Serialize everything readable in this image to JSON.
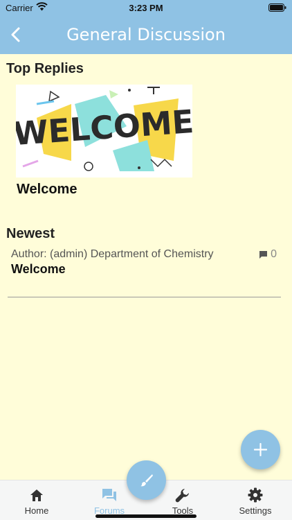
{
  "status_bar": {
    "carrier": "Carrier",
    "time": "3:23 PM"
  },
  "nav": {
    "title": "General Discussion",
    "back_icon": "chevron-left-icon"
  },
  "top_replies": {
    "heading": "Top Replies",
    "items": [
      {
        "image_text": "WELCOME",
        "title": "Welcome"
      }
    ]
  },
  "newest": {
    "heading": "Newest",
    "items": [
      {
        "author": "Author: (admin) Department of Chemistry",
        "title": "Welcome",
        "comments": "0"
      }
    ]
  },
  "fab": {
    "add_icon": "plus-icon",
    "compose_icon": "brush-icon"
  },
  "tabs": [
    {
      "label": "Home",
      "icon": "home-icon",
      "active": false
    },
    {
      "label": "Forums",
      "icon": "forum-icon",
      "active": true
    },
    {
      "label": "Tools",
      "icon": "wrench-icon",
      "active": false
    },
    {
      "label": "Settings",
      "icon": "gear-icon",
      "active": false
    }
  ],
  "colors": {
    "accent": "#8fc2e4",
    "background": "#fffdd9"
  }
}
